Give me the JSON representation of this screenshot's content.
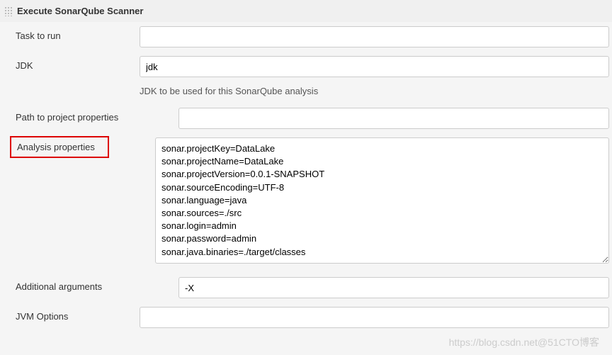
{
  "section": {
    "title": "Execute SonarQube Scanner"
  },
  "fields": {
    "taskToRun": {
      "label": "Task to run",
      "value": ""
    },
    "jdk": {
      "label": "JDK",
      "value": "jdk",
      "help": "JDK to be used for this SonarQube analysis"
    },
    "pathToProjectProperties": {
      "label": "Path to project properties",
      "value": ""
    },
    "analysisProperties": {
      "label": "Analysis properties",
      "value": "sonar.projectKey=DataLake\nsonar.projectName=DataLake\nsonar.projectVersion=0.0.1-SNAPSHOT\nsonar.sourceEncoding=UTF-8\nsonar.language=java\nsonar.sources=./src\nsonar.login=admin\nsonar.password=admin\nsonar.java.binaries=./target/classes"
    },
    "additionalArguments": {
      "label": "Additional arguments",
      "value": "-X"
    },
    "jvmOptions": {
      "label": "JVM Options",
      "value": ""
    }
  },
  "watermark": "https://blog.csdn.net@51CTO博客"
}
